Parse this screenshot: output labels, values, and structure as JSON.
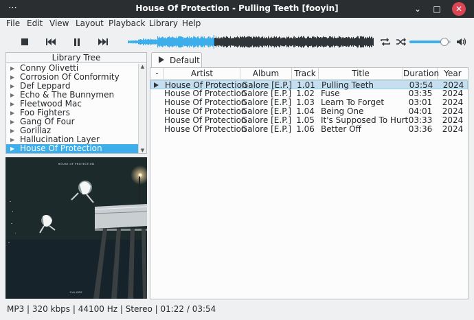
{
  "window": {
    "title": "House Of Protection - Pulling Teeth [fooyin]",
    "menu_dots": "⋯",
    "minimize_icon": "⌄",
    "maximize_icon": "□",
    "close_icon": "✕"
  },
  "menubar": [
    "File",
    "Edit",
    "View",
    "Layout",
    "Playback",
    "Library",
    "Help"
  ],
  "toolbar": {
    "stop_icon": "stop-icon",
    "prev_icon": "⏮",
    "pause_icon": "⏸",
    "next_icon": "⏭",
    "repeat_icon": "🔁",
    "shuffle_icon": "🔀",
    "volume_icon": "🔊",
    "volume_level": 0.85,
    "seek_position": 0.35
  },
  "library": {
    "header": "Library Tree",
    "items": [
      "Conny Olivetti",
      "Corrosion Of Conformity",
      "Def Leppard",
      "Echo & The Bunnymen",
      "Fleetwood Mac",
      "Foo Fighters",
      "Gang Of Four",
      "Gorillaz",
      "Hallucination Layer",
      "House Of Protection"
    ],
    "selected_index": 9
  },
  "cover": {
    "band_text": "HOUSE OF PROTECTION",
    "album_text": "GALORE"
  },
  "playlist": {
    "tab_label": "Default",
    "columns": [
      "-",
      "Artist",
      "Album",
      "Track",
      "Title",
      "Duration",
      "Year"
    ],
    "rows": [
      {
        "artist": "House Of Protection",
        "album": "Galore [E.P.]",
        "track": "1.01",
        "title": "Pulling Teeth",
        "duration": "03:54",
        "year": "2024",
        "playing": true
      },
      {
        "artist": "House Of Protection",
        "album": "Galore [E.P.]",
        "track": "1.02",
        "title": "Fuse",
        "duration": "03:35",
        "year": "2024",
        "playing": false
      },
      {
        "artist": "House Of Protection",
        "album": "Galore [E.P.]",
        "track": "1.03",
        "title": "Learn To Forget",
        "duration": "03:01",
        "year": "2024",
        "playing": false
      },
      {
        "artist": "House Of Protection",
        "album": "Galore [E.P.]",
        "track": "1.04",
        "title": "Being One",
        "duration": "04:01",
        "year": "2024",
        "playing": false
      },
      {
        "artist": "House Of Protection",
        "album": "Galore [E.P.]",
        "track": "1.05",
        "title": "It's Supposed To Hurt",
        "duration": "03:33",
        "year": "2024",
        "playing": false
      },
      {
        "artist": "House Of Protection",
        "album": "Galore [E.P.]",
        "track": "1.06",
        "title": "Better Off",
        "duration": "03:36",
        "year": "2024",
        "playing": false
      }
    ]
  },
  "status": {
    "text": "MP3 | 320 kbps | 44100 Hz | Stereo | 01:22 / 03:54"
  },
  "colors": {
    "accent": "#3daee9",
    "titlebar": "#2b2e31",
    "close": "#da4453",
    "waveform_played": "#3daee9",
    "waveform_unplayed": "#31363b"
  }
}
